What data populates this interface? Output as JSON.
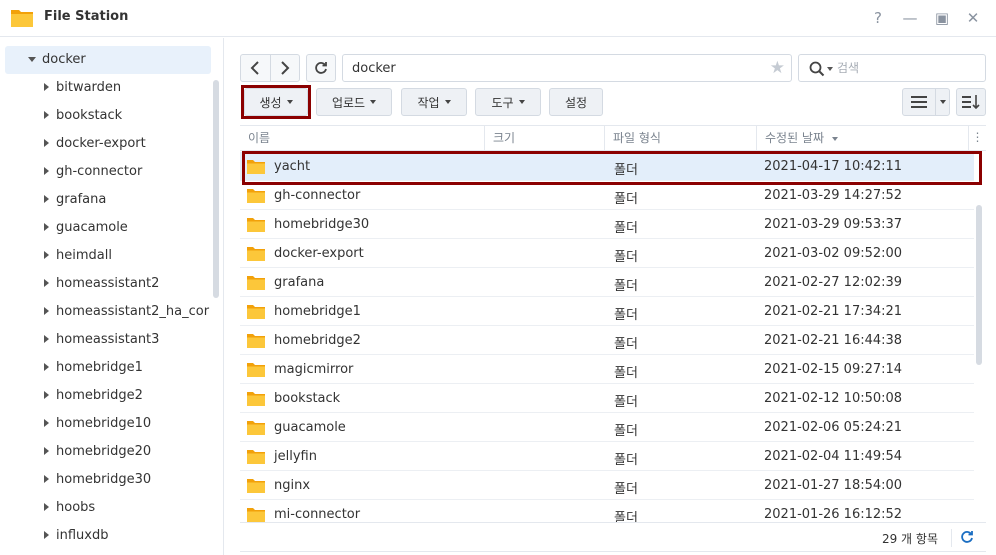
{
  "window": {
    "title": "File Station",
    "help_label": "?",
    "minimize_label": "—",
    "maximize_label": "▣",
    "close_label": "✕"
  },
  "colors": {
    "accent": "#1b6ec2",
    "folder": "#f9b31a",
    "highlight_box": "#8b0000",
    "selected_row": "#e3eefa"
  },
  "sidebar": {
    "root": "docker",
    "items": [
      "bitwarden",
      "bookstack",
      "docker-export",
      "gh-connector",
      "grafana",
      "guacamole",
      "heimdall",
      "homeassistant2",
      "homeassistant2_ha_cor",
      "homeassistant3",
      "homebridge1",
      "homebridge2",
      "homebridge10",
      "homebridge20",
      "homebridge30",
      "hoobs",
      "influxdb"
    ]
  },
  "toolbar": {
    "path": "docker",
    "search_placeholder": "검색",
    "create_label": "생성",
    "upload_label": "업로드",
    "action_label": "작업",
    "tools_label": "도구",
    "settings_label": "설정"
  },
  "table": {
    "headers": {
      "name": "이름",
      "size": "크기",
      "type": "파일 형식",
      "modified": "수정된 날짜",
      "menu": "⋮"
    },
    "rows": [
      {
        "name": "yacht",
        "type": "폴더",
        "modified": "2021-04-17 10:42:11",
        "selected": true
      },
      {
        "name": "gh-connector",
        "type": "폴더",
        "modified": "2021-03-29 14:27:52"
      },
      {
        "name": "homebridge30",
        "type": "폴더",
        "modified": "2021-03-29 09:53:37"
      },
      {
        "name": "docker-export",
        "type": "폴더",
        "modified": "2021-03-02 09:52:00"
      },
      {
        "name": "grafana",
        "type": "폴더",
        "modified": "2021-02-27 12:02:39"
      },
      {
        "name": "homebridge1",
        "type": "폴더",
        "modified": "2021-02-21 17:34:21"
      },
      {
        "name": "homebridge2",
        "type": "폴더",
        "modified": "2021-02-21 16:44:38"
      },
      {
        "name": "magicmirror",
        "type": "폴더",
        "modified": "2021-02-15 09:27:14"
      },
      {
        "name": "bookstack",
        "type": "폴더",
        "modified": "2021-02-12 10:50:08"
      },
      {
        "name": "guacamole",
        "type": "폴더",
        "modified": "2021-02-06 05:24:21"
      },
      {
        "name": "jellyfin",
        "type": "폴더",
        "modified": "2021-02-04 11:49:54"
      },
      {
        "name": "nginx",
        "type": "폴더",
        "modified": "2021-01-27 18:54:00"
      },
      {
        "name": "mi-connector",
        "type": "폴더",
        "modified": "2021-01-26 16:12:52"
      }
    ]
  },
  "status": {
    "count": "29 개 항목"
  }
}
